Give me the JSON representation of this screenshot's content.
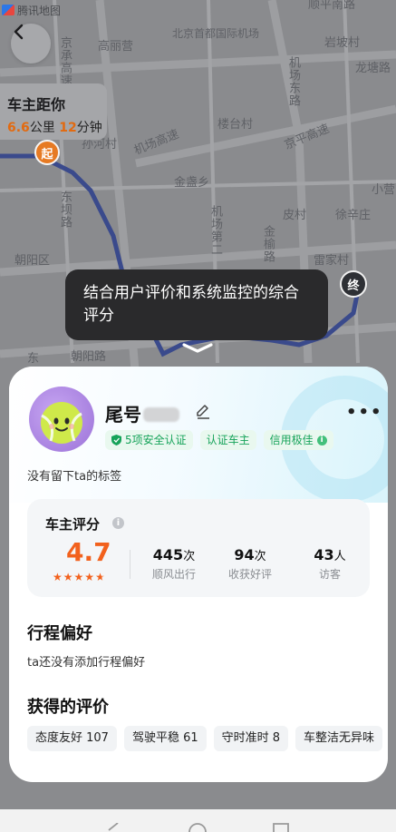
{
  "map": {
    "provider": "腾讯地图",
    "labels": [
      {
        "text": "顺平南路",
        "id": "a"
      },
      {
        "text": "北京首都国际机场",
        "id": "b"
      },
      {
        "text": "岩坡村",
        "id": "c"
      },
      {
        "text": "京承高速",
        "id": "d"
      },
      {
        "text": "高丽营",
        "id": "e"
      },
      {
        "text": "龙塘路",
        "id": "f"
      },
      {
        "text": "机场东路",
        "id": "g"
      },
      {
        "text": "楼台村",
        "id": "h"
      },
      {
        "text": "孙河村",
        "id": "i"
      },
      {
        "text": "机场高速",
        "id": "j"
      },
      {
        "text": "京平高速",
        "id": "k"
      },
      {
        "text": "金盏乡",
        "id": "l"
      },
      {
        "text": "东坝路",
        "id": "m"
      },
      {
        "text": "机场第二",
        "id": "n"
      },
      {
        "text": "皮村",
        "id": "o"
      },
      {
        "text": "徐辛庄",
        "id": "p"
      },
      {
        "text": "金榆路",
        "id": "q"
      },
      {
        "text": "小营",
        "id": "r"
      },
      {
        "text": "朝阳区",
        "id": "s"
      },
      {
        "text": "雷家村",
        "id": "t"
      },
      {
        "text": "朝阳路",
        "id": "u"
      },
      {
        "text": "东",
        "id": "v"
      }
    ]
  },
  "distance_card": {
    "title": "车主距你",
    "km_value": "6.6",
    "km_unit": "公里",
    "min_value": "12",
    "min_unit": "分钟"
  },
  "pins": {
    "start": "起",
    "end": "终"
  },
  "tooltip": {
    "text": "结合用户评价和系统监控的综合评分"
  },
  "profile": {
    "name_prefix": "尾号",
    "badges": [
      "5项安全认证",
      "认证车主",
      "信用极佳"
    ],
    "tag_line": "没有留下ta的标签"
  },
  "score": {
    "title": "车主评分",
    "rating": "4.7",
    "stars": 4.7,
    "stats": [
      {
        "value": "445",
        "unit": "次",
        "label": "顺风出行"
      },
      {
        "value": "94",
        "unit": "次",
        "label": "收获好评"
      },
      {
        "value": "43",
        "unit": "人",
        "label": "访客"
      }
    ]
  },
  "preference": {
    "title": "行程偏好",
    "text": "ta还没有添加行程偏好"
  },
  "reviews": {
    "title": "获得的评价",
    "chips": [
      "态度友好 107",
      "驾驶平稳 61",
      "守时准时 8",
      "车整洁无异味"
    ]
  },
  "colors": {
    "accent": "#f2611d",
    "green": "#16a35a",
    "route": "#3a4a8c"
  },
  "icons": [
    "back-arrow-icon",
    "edit-pencil-icon",
    "more-dots-icon",
    "shield-check-icon",
    "info-icon",
    "chevron-down-icon",
    "nav-back-icon",
    "nav-home-icon",
    "nav-recents-icon"
  ]
}
